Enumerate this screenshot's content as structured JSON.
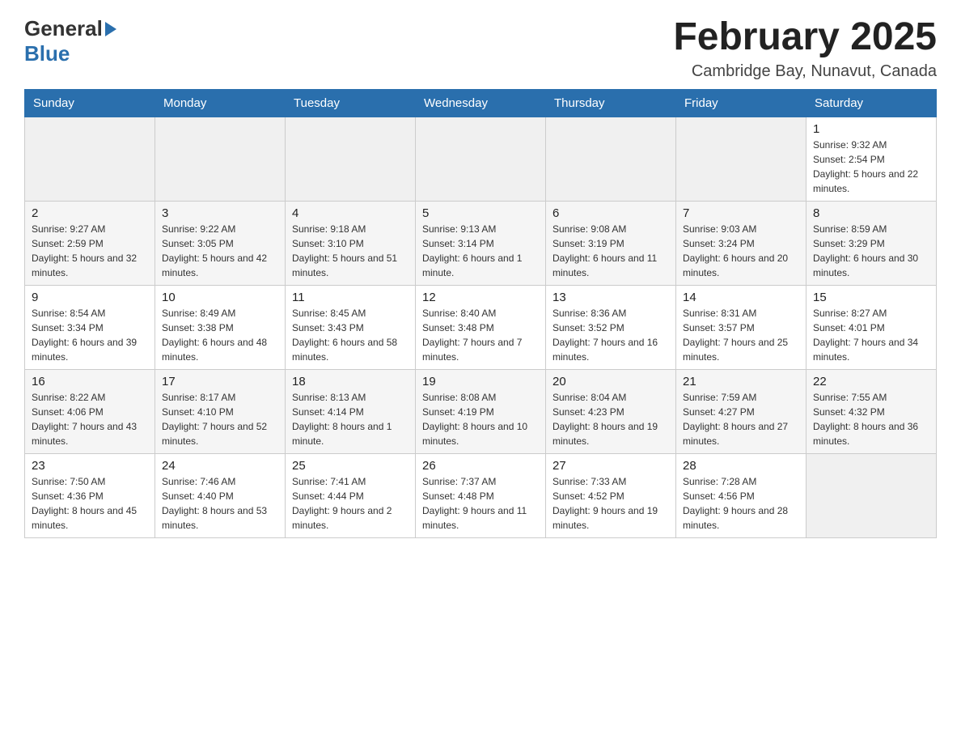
{
  "header": {
    "logo_general": "General",
    "logo_blue": "Blue",
    "month_title": "February 2025",
    "location": "Cambridge Bay, Nunavut, Canada"
  },
  "days_of_week": [
    "Sunday",
    "Monday",
    "Tuesday",
    "Wednesday",
    "Thursday",
    "Friday",
    "Saturday"
  ],
  "weeks": [
    {
      "cells": [
        {
          "day": "",
          "info": ""
        },
        {
          "day": "",
          "info": ""
        },
        {
          "day": "",
          "info": ""
        },
        {
          "day": "",
          "info": ""
        },
        {
          "day": "",
          "info": ""
        },
        {
          "day": "",
          "info": ""
        },
        {
          "day": "1",
          "info": "Sunrise: 9:32 AM\nSunset: 2:54 PM\nDaylight: 5 hours and 22 minutes."
        }
      ]
    },
    {
      "cells": [
        {
          "day": "2",
          "info": "Sunrise: 9:27 AM\nSunset: 2:59 PM\nDaylight: 5 hours and 32 minutes."
        },
        {
          "day": "3",
          "info": "Sunrise: 9:22 AM\nSunset: 3:05 PM\nDaylight: 5 hours and 42 minutes."
        },
        {
          "day": "4",
          "info": "Sunrise: 9:18 AM\nSunset: 3:10 PM\nDaylight: 5 hours and 51 minutes."
        },
        {
          "day": "5",
          "info": "Sunrise: 9:13 AM\nSunset: 3:14 PM\nDaylight: 6 hours and 1 minute."
        },
        {
          "day": "6",
          "info": "Sunrise: 9:08 AM\nSunset: 3:19 PM\nDaylight: 6 hours and 11 minutes."
        },
        {
          "day": "7",
          "info": "Sunrise: 9:03 AM\nSunset: 3:24 PM\nDaylight: 6 hours and 20 minutes."
        },
        {
          "day": "8",
          "info": "Sunrise: 8:59 AM\nSunset: 3:29 PM\nDaylight: 6 hours and 30 minutes."
        }
      ]
    },
    {
      "cells": [
        {
          "day": "9",
          "info": "Sunrise: 8:54 AM\nSunset: 3:34 PM\nDaylight: 6 hours and 39 minutes."
        },
        {
          "day": "10",
          "info": "Sunrise: 8:49 AM\nSunset: 3:38 PM\nDaylight: 6 hours and 48 minutes."
        },
        {
          "day": "11",
          "info": "Sunrise: 8:45 AM\nSunset: 3:43 PM\nDaylight: 6 hours and 58 minutes."
        },
        {
          "day": "12",
          "info": "Sunrise: 8:40 AM\nSunset: 3:48 PM\nDaylight: 7 hours and 7 minutes."
        },
        {
          "day": "13",
          "info": "Sunrise: 8:36 AM\nSunset: 3:52 PM\nDaylight: 7 hours and 16 minutes."
        },
        {
          "day": "14",
          "info": "Sunrise: 8:31 AM\nSunset: 3:57 PM\nDaylight: 7 hours and 25 minutes."
        },
        {
          "day": "15",
          "info": "Sunrise: 8:27 AM\nSunset: 4:01 PM\nDaylight: 7 hours and 34 minutes."
        }
      ]
    },
    {
      "cells": [
        {
          "day": "16",
          "info": "Sunrise: 8:22 AM\nSunset: 4:06 PM\nDaylight: 7 hours and 43 minutes."
        },
        {
          "day": "17",
          "info": "Sunrise: 8:17 AM\nSunset: 4:10 PM\nDaylight: 7 hours and 52 minutes."
        },
        {
          "day": "18",
          "info": "Sunrise: 8:13 AM\nSunset: 4:14 PM\nDaylight: 8 hours and 1 minute."
        },
        {
          "day": "19",
          "info": "Sunrise: 8:08 AM\nSunset: 4:19 PM\nDaylight: 8 hours and 10 minutes."
        },
        {
          "day": "20",
          "info": "Sunrise: 8:04 AM\nSunset: 4:23 PM\nDaylight: 8 hours and 19 minutes."
        },
        {
          "day": "21",
          "info": "Sunrise: 7:59 AM\nSunset: 4:27 PM\nDaylight: 8 hours and 27 minutes."
        },
        {
          "day": "22",
          "info": "Sunrise: 7:55 AM\nSunset: 4:32 PM\nDaylight: 8 hours and 36 minutes."
        }
      ]
    },
    {
      "cells": [
        {
          "day": "23",
          "info": "Sunrise: 7:50 AM\nSunset: 4:36 PM\nDaylight: 8 hours and 45 minutes."
        },
        {
          "day": "24",
          "info": "Sunrise: 7:46 AM\nSunset: 4:40 PM\nDaylight: 8 hours and 53 minutes."
        },
        {
          "day": "25",
          "info": "Sunrise: 7:41 AM\nSunset: 4:44 PM\nDaylight: 9 hours and 2 minutes."
        },
        {
          "day": "26",
          "info": "Sunrise: 7:37 AM\nSunset: 4:48 PM\nDaylight: 9 hours and 11 minutes."
        },
        {
          "day": "27",
          "info": "Sunrise: 7:33 AM\nSunset: 4:52 PM\nDaylight: 9 hours and 19 minutes."
        },
        {
          "day": "28",
          "info": "Sunrise: 7:28 AM\nSunset: 4:56 PM\nDaylight: 9 hours and 28 minutes."
        },
        {
          "day": "",
          "info": ""
        }
      ]
    }
  ]
}
